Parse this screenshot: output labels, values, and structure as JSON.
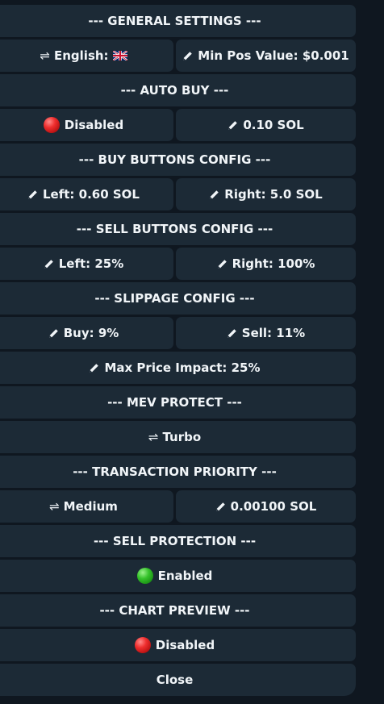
{
  "rows": {
    "general_header": "--- GENERAL SETTINGS ---",
    "language": "English:",
    "language_flag_icon": "uk-flag-icon",
    "min_pos_value": "Min Pos Value: $0.001",
    "auto_buy_header": "--- AUTO BUY ---",
    "auto_buy_status": "Disabled",
    "auto_buy_amount": "0.10 SOL",
    "buy_buttons_header": "--- BUY BUTTONS CONFIG ---",
    "buy_left": "Left: 0.60 SOL",
    "buy_right": "Right: 5.0 SOL",
    "sell_buttons_header": "--- SELL BUTTONS CONFIG ---",
    "sell_left": "Left: 25%",
    "sell_right": "Right: 100%",
    "slippage_header": "--- SLIPPAGE CONFIG ---",
    "slippage_buy": "Buy: 9%",
    "slippage_sell": "Sell: 11%",
    "max_price_impact": "Max Price Impact: 25%",
    "mev_header": "--- MEV PROTECT ---",
    "mev_mode": "Turbo",
    "tx_priority_header": "--- TRANSACTION PRIORITY ---",
    "tx_priority_level": "Medium",
    "tx_priority_fee": "0.00100 SOL",
    "sell_protection_header": "--- SELL PROTECTION ---",
    "sell_protection_status": "Enabled",
    "chart_preview_header": "--- CHART PREVIEW ---",
    "chart_preview_status": "Disabled",
    "close": "Close"
  },
  "colors": {
    "background": "#0f1720",
    "button": "#1c2a36",
    "text": "#f1f5f8",
    "disabled_dot": "#ef2e2e",
    "enabled_dot": "#34c22a"
  },
  "icons": {
    "edit": "pencil-icon",
    "toggle": "swap-arrows-icon",
    "disabled": "red-circle-icon",
    "enabled": "green-circle-icon"
  }
}
